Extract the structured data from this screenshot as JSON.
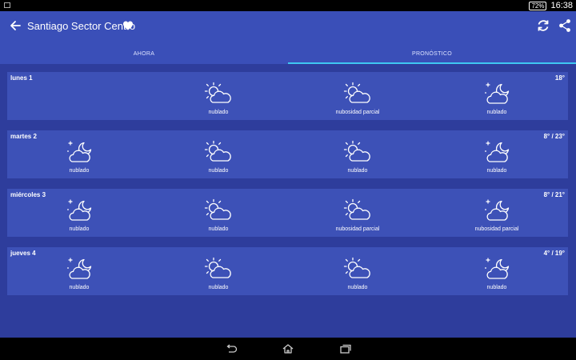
{
  "status": {
    "battery": "72%",
    "time": "16:38"
  },
  "appbar": {
    "title": "Santiago Sector Centro"
  },
  "tabs": [
    {
      "label": "AHORA",
      "active": false
    },
    {
      "label": "PRONÓSTICO",
      "active": true
    }
  ],
  "days": [
    {
      "label": "lunes 1",
      "temp": "18°",
      "slots": [
        null,
        {
          "icon": "sun-cloud-icon",
          "condition": "nublado"
        },
        {
          "icon": "sun-cloud-icon",
          "condition": "nubosidad parcial"
        },
        {
          "icon": "moon-cloud-icon",
          "condition": "nublado"
        }
      ]
    },
    {
      "label": "martes 2",
      "temp": "8° / 23°",
      "slots": [
        {
          "icon": "moon-cloud-icon",
          "condition": "nublado"
        },
        {
          "icon": "sun-cloud-icon",
          "condition": "nublado"
        },
        {
          "icon": "sun-cloud-icon",
          "condition": "nublado"
        },
        {
          "icon": "moon-cloud-icon",
          "condition": "nublado"
        }
      ]
    },
    {
      "label": "miércoles 3",
      "temp": "8° / 21°",
      "slots": [
        {
          "icon": "moon-cloud-icon",
          "condition": "nublado"
        },
        {
          "icon": "sun-cloud-icon",
          "condition": "nublado"
        },
        {
          "icon": "sun-cloud-icon",
          "condition": "nubosidad parcial"
        },
        {
          "icon": "moon-cloud-icon",
          "condition": "nubosidad parcial"
        }
      ]
    },
    {
      "label": "jueves 4",
      "temp": "4° / 19°",
      "slots": [
        {
          "icon": "moon-cloud-icon",
          "condition": "nublado"
        },
        {
          "icon": "sun-cloud-icon",
          "condition": "nublado"
        },
        {
          "icon": "sun-cloud-icon",
          "condition": "nublado"
        },
        {
          "icon": "moon-cloud-icon",
          "condition": "nublado"
        }
      ]
    }
  ]
}
